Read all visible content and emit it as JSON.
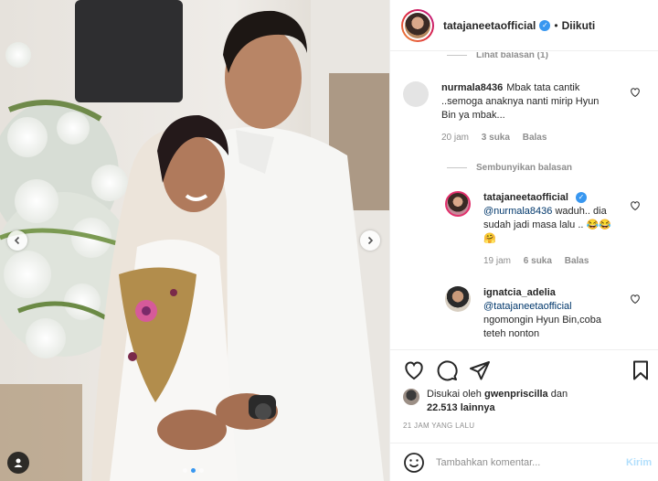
{
  "header": {
    "username": "tatajaneetaofficial",
    "separator": "•",
    "follow_status": "Diikuti",
    "verified_mark": "✓"
  },
  "comments": {
    "view_replies_top": "Lihat balasan (1)",
    "hide_replies": "Sembunyikan balasan",
    "items": [
      {
        "username": "nurmala8436",
        "text": "Mbak tata cantik ..semoga anaknya nanti mirip Hyun Bin ya mbak...",
        "time": "20 jam",
        "likes": "3 suka",
        "reply": "Balas"
      },
      {
        "username": "tatajaneetaofficial",
        "mention": "@nurmala8436",
        "text": " waduh.. dia sudah jadi masa lalu .. 😂😂🤗",
        "time": "19 jam",
        "likes": "6 suka",
        "reply": "Balas"
      },
      {
        "username": "ignatcia_adelia",
        "mention": "@tatajaneetaofficial",
        "text": " ngomongin Hyun Bin,coba teteh nonton"
      }
    ]
  },
  "likes": {
    "prefix": "Disukai oleh",
    "user": "gwenpriscilla",
    "connector": "dan",
    "count": "22.513 lainnya"
  },
  "timestamp": "21 JAM YANG LALU",
  "add_comment": {
    "placeholder": "Tambahkan komentar...",
    "post_label": "Kirim"
  },
  "icons": {
    "heart": "heart-icon",
    "comment": "comment-icon",
    "share": "paper-plane-icon",
    "save": "bookmark-icon",
    "emoji": "smiley-icon",
    "tag": "person-tag-icon",
    "prev": "chevron-left-icon",
    "next": "chevron-right-icon"
  },
  "colors": {
    "link": "#00376b",
    "verified": "#3897f0",
    "muted": "#8e8e8e",
    "post_disabled": "#b2dffc"
  }
}
